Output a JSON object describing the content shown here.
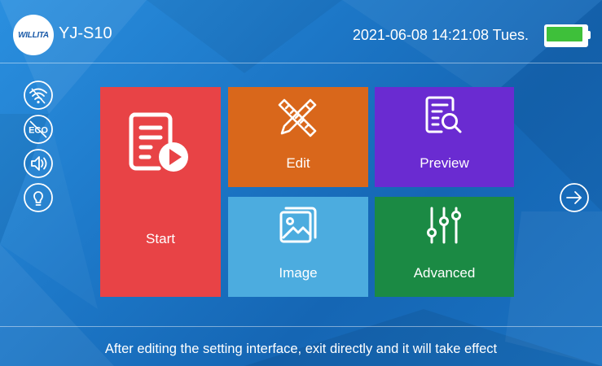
{
  "header": {
    "logo_text": "WILLITA",
    "device_name": "YJ-S10",
    "datetime": "2021-06-08 14:21:08 Tues.",
    "battery_icon": "battery-icon"
  },
  "sidebar": {
    "icons": [
      "wifi-icon",
      "eco-icon",
      "speaker-icon",
      "lightbulb-icon"
    ]
  },
  "tiles": {
    "start": {
      "label": "Start",
      "icon": "document-play-icon",
      "color": "#e84346"
    },
    "edit": {
      "label": "Edit",
      "icon": "pencil-ruler-icon",
      "color": "#d9671b"
    },
    "preview": {
      "label": "Preview",
      "icon": "document-search-icon",
      "color": "#6a2bd1"
    },
    "image": {
      "label": "Image",
      "icon": "image-icon",
      "color": "#4cacdf"
    },
    "advanced": {
      "label": "Advanced",
      "icon": "sliders-icon",
      "color": "#1b8a44"
    }
  },
  "navigation": {
    "next_icon": "arrow-right-circle-icon"
  },
  "footer": {
    "message": "After editing the setting interface, exit directly and it will take effect"
  }
}
